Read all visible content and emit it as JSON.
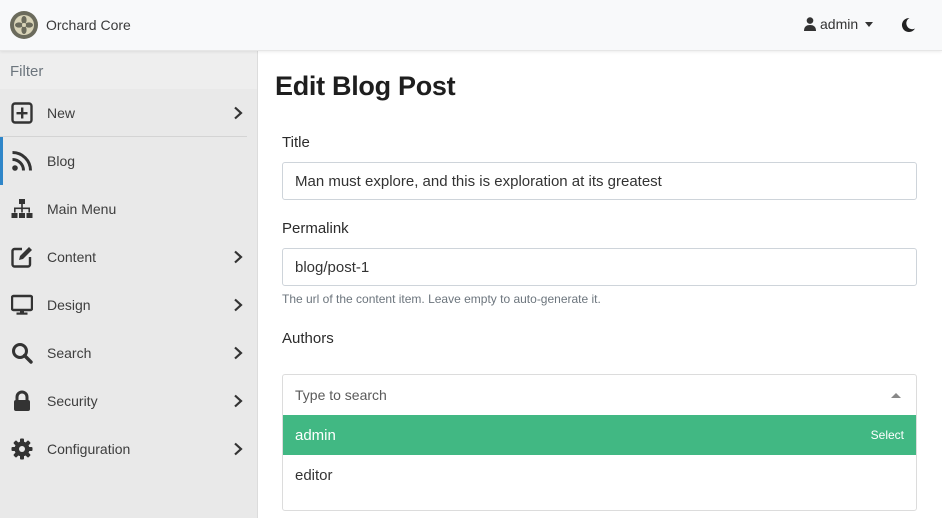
{
  "header": {
    "brand": "Orchard Core",
    "user": "admin",
    "icons": {
      "logo": "orchard-logo",
      "user": "user-icon",
      "theme": "moon-icon",
      "caret": "caret-down-icon"
    }
  },
  "sidebar": {
    "filter_placeholder": "Filter",
    "items": [
      {
        "label": "New",
        "icon": "plus-square-icon",
        "has_children": true
      },
      {
        "label": "Blog",
        "icon": "rss-icon",
        "has_children": false,
        "active": true
      },
      {
        "label": "Main Menu",
        "icon": "sitemap-icon",
        "has_children": false
      },
      {
        "label": "Content",
        "icon": "edit-icon",
        "has_children": true
      },
      {
        "label": "Design",
        "icon": "desktop-icon",
        "has_children": true
      },
      {
        "label": "Search",
        "icon": "search-icon",
        "has_children": true
      },
      {
        "label": "Security",
        "icon": "lock-icon",
        "has_children": true
      },
      {
        "label": "Configuration",
        "icon": "cog-icon",
        "has_children": true
      }
    ],
    "active_color": "#2f86c9"
  },
  "main": {
    "title": "Edit Blog Post",
    "title_field": {
      "label": "Title",
      "value": "Man must explore, and this is exploration at its greatest"
    },
    "permalink_field": {
      "label": "Permalink",
      "value": "blog/post-1",
      "hint": "The url of the content item. Leave empty to auto-generate it."
    },
    "authors_field": {
      "label": "Authors",
      "search_placeholder": "Type to search",
      "options": [
        {
          "label": "admin",
          "hint": "Select",
          "highlighted": true
        },
        {
          "label": "editor"
        }
      ],
      "highlight_color": "#41b883"
    }
  }
}
